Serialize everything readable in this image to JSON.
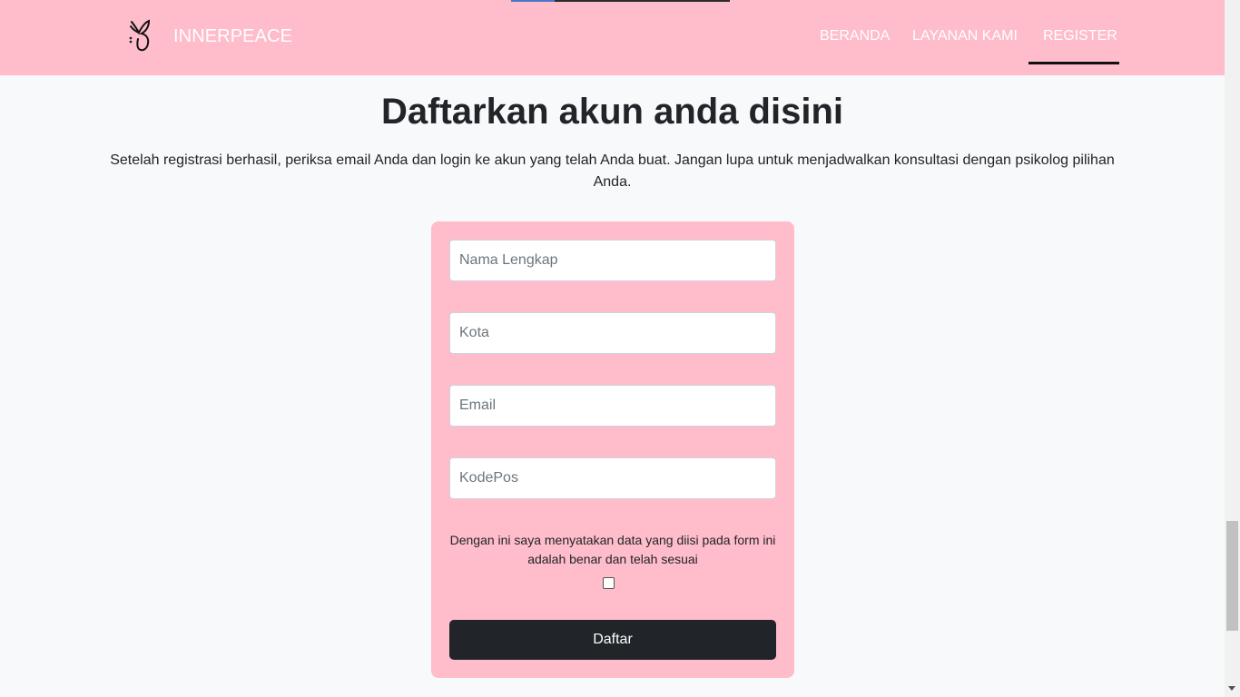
{
  "navbar": {
    "brand": "INNERPEACE",
    "logo_icon": "butterfly-icon",
    "items": [
      {
        "label": "BERANDA"
      },
      {
        "label": "LAYANAN KAMI"
      },
      {
        "label": "REGISTER",
        "active": true
      }
    ]
  },
  "main": {
    "title": "Daftarkan akun anda disini",
    "subtitle": "Setelah registrasi berhasil, periksa email Anda dan login ke akun yang telah Anda buat. Jangan lupa untuk menjadwalkan konsultasi dengan psikolog pilihan Anda."
  },
  "form": {
    "fields": [
      {
        "placeholder": "Nama Lengkap",
        "value": ""
      },
      {
        "placeholder": "Kota",
        "value": ""
      },
      {
        "placeholder": "Email",
        "value": ""
      },
      {
        "placeholder": "KodePos",
        "value": ""
      }
    ],
    "consent_text": "Dengan ini saya menyatakan data yang diisi pada form ini adalah benar dan telah sesuai",
    "consent_checked": false,
    "submit_label": "Daftar"
  },
  "colors": {
    "navbar_bg": "#ffbccb",
    "card_bg": "#ffbccb",
    "button_bg": "#212529",
    "page_bg": "#f8f9fa"
  }
}
